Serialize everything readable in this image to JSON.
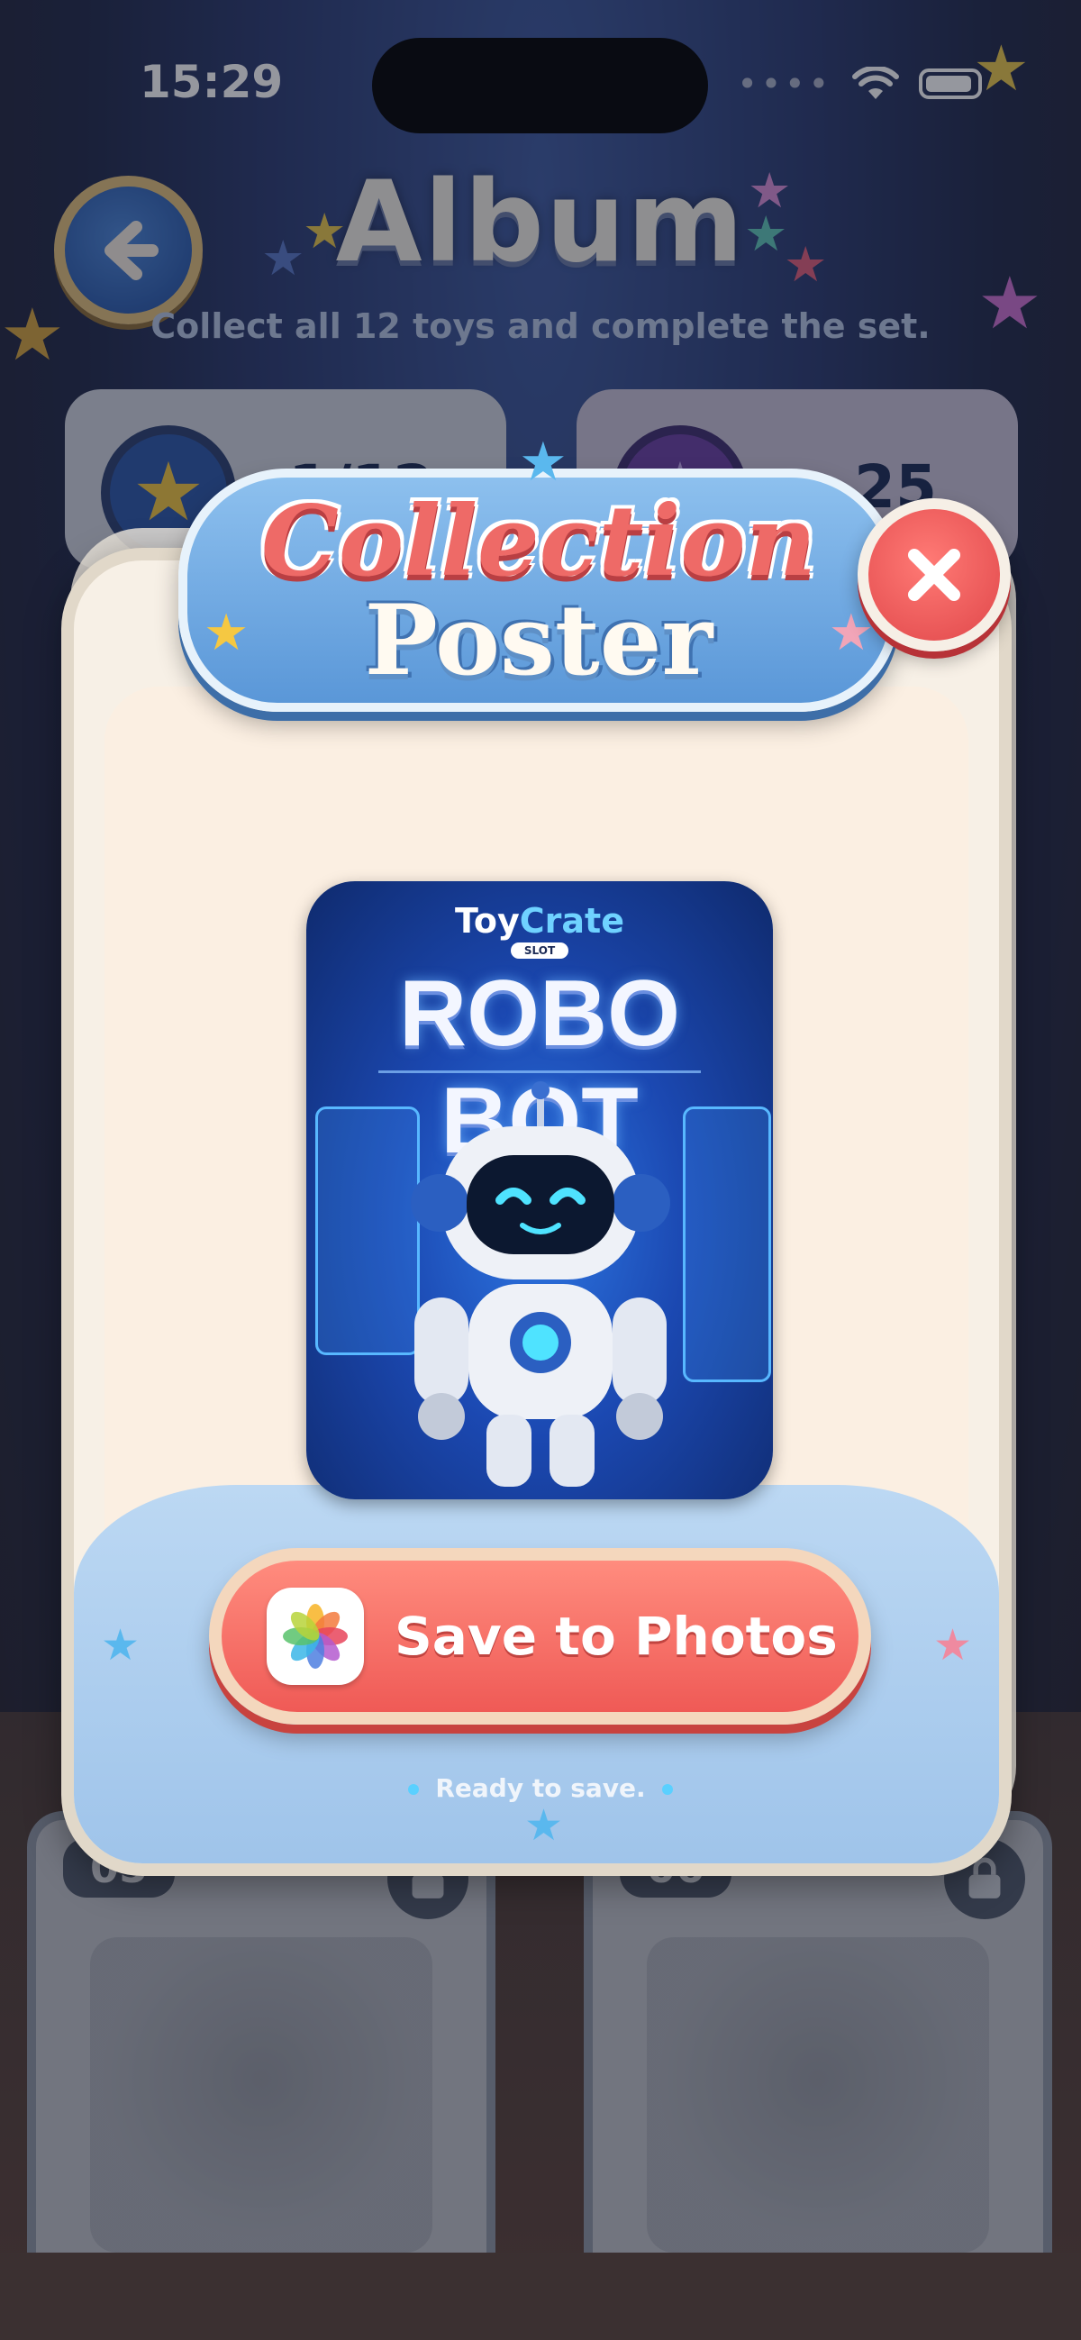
{
  "status_bar": {
    "time": "15:29",
    "signal": "••••"
  },
  "header": {
    "title": "Album",
    "subtitle": "Collect all 12 toys and complete the set."
  },
  "stats": [
    {
      "value": "1/12",
      "icon": "star-icon"
    },
    {
      "value": "25",
      "icon": "star-icon"
    }
  ],
  "toy_cards": [
    {
      "number": "05",
      "locked": true,
      "icon": "race-car"
    },
    {
      "number": "06",
      "locked": true,
      "icon": "dinosaur"
    }
  ],
  "modal": {
    "title_line1": "Collection",
    "title_line2": "Poster",
    "close_icon": "x-icon",
    "poster": {
      "brand_part1": "Toy",
      "brand_part2": "Crate",
      "brand_tag": "SLOT",
      "toy_name": "ROBO BOT"
    },
    "save_button_label": "Save to Photos",
    "save_icon": "photos-icon",
    "status": "Ready to save."
  },
  "colors": {
    "accent_red": "#ef5a56",
    "accent_blue": "#5a97d8",
    "panel_cream": "#f7f0e6"
  }
}
